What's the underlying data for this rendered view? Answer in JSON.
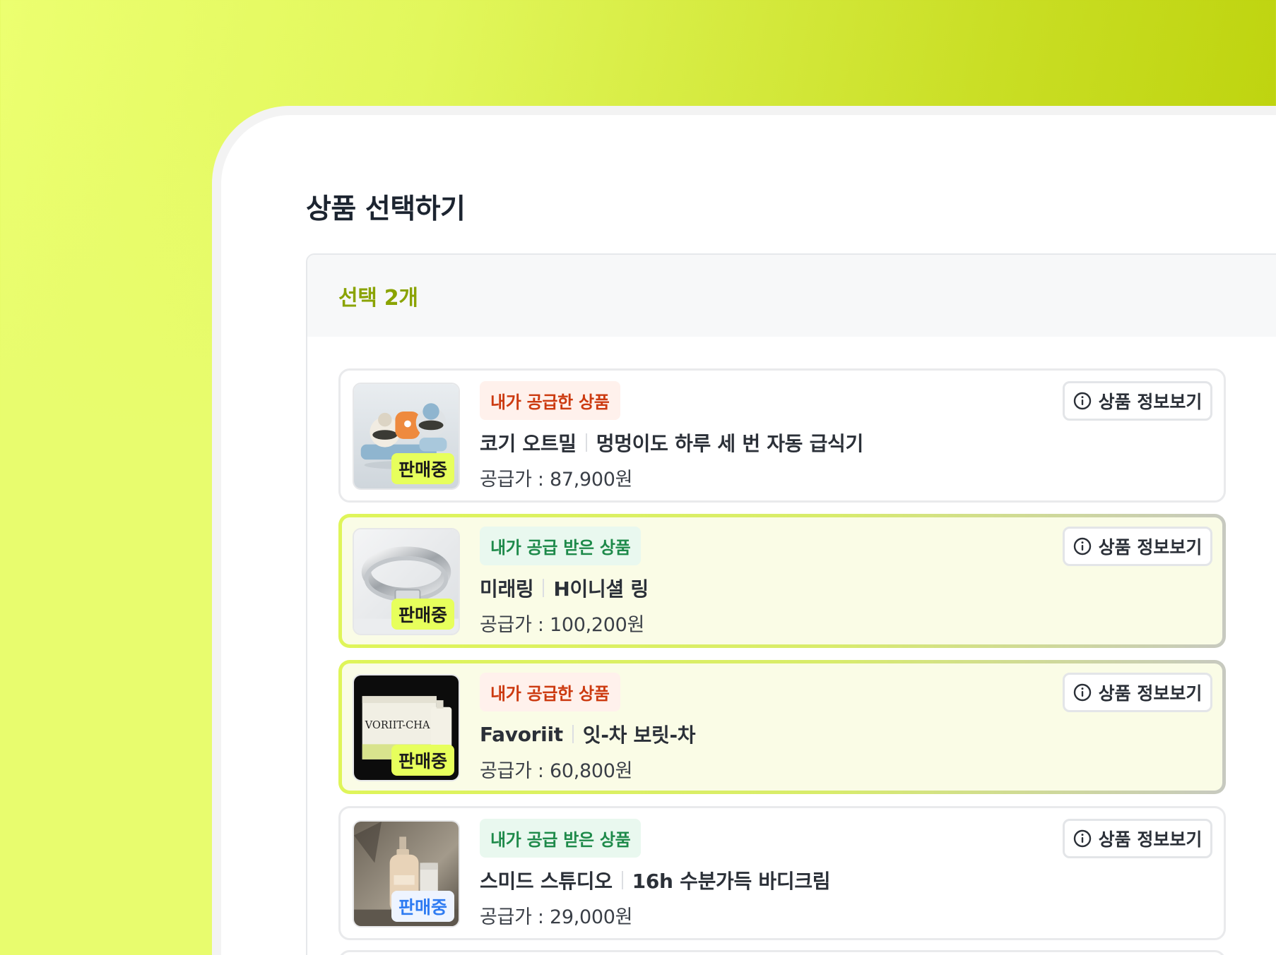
{
  "page": {
    "title": "상품 선택하기",
    "selection_count": "선택 2개"
  },
  "colors": {
    "accent": "#8aa302",
    "selected_bg": "#fafce6",
    "tag_mine": "#cc3a10",
    "tag_received": "#1e8a4a",
    "badge_lime": "#e7ff5c",
    "badge_blue": "#2e7bf2"
  },
  "products": [
    {
      "supply_tag": "내가 공급한 상품",
      "brand": "코기 오트밀",
      "name": "멍멍이도 하루 세 번 자동 급식기",
      "price": "공급가 : 87,900원",
      "status": "판매중",
      "info_button": "상품 정보보기",
      "thumbnail": "pet-feeder-image"
    },
    {
      "supply_tag": "내가 공급 받은 상품",
      "brand": "미래링",
      "name": "H이니셜 링",
      "price": "공급가 : 100,200원",
      "status": "판매중",
      "info_button": "상품 정보보기",
      "thumbnail": "silver-ring-image"
    },
    {
      "supply_tag": "내가 공급한 상품",
      "brand": "Favoriit",
      "name": "잇-차 보릿-차",
      "price": "공급가 : 60,800원",
      "status": "판매중",
      "info_button": "상품 정보보기",
      "thumbnail": "tea-box-image",
      "thumbnail_text": "VORIIT-CHA"
    },
    {
      "supply_tag": "내가 공급 받은 상품",
      "brand": "스미드 스튜디오",
      "name": "16h 수분가득 바디크림",
      "price": "공급가 : 29,000원",
      "status": "판매중",
      "info_button": "상품 정보보기",
      "thumbnail": "body-cream-image"
    }
  ]
}
